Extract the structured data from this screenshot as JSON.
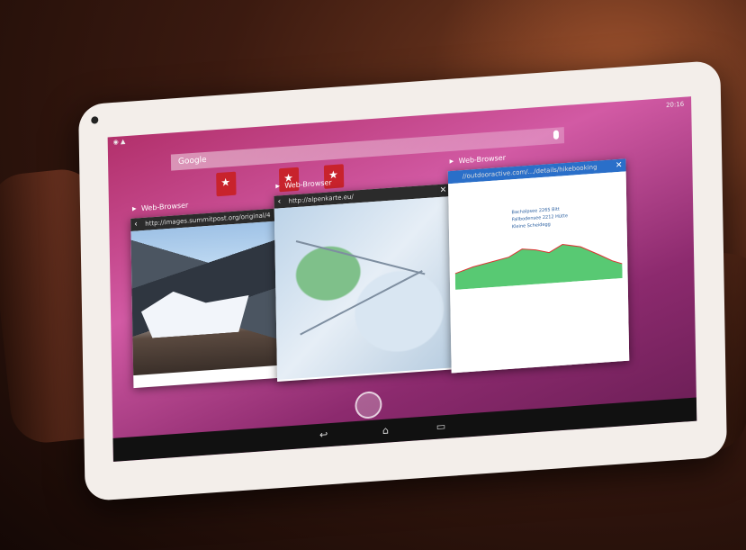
{
  "scene": "tablet held in hands showing recent apps",
  "colors": {
    "accent": "#c8232c",
    "wallpaper": "#b2306b"
  },
  "statusbar": {
    "time": "20:16",
    "icons": [
      "signal-icon",
      "wifi-icon",
      "battery-icon"
    ]
  },
  "search": {
    "label": "Google"
  },
  "cards": [
    {
      "title": "Web-Browser",
      "url": "http://images.summitpost.org/original/4"
    },
    {
      "title": "Web-Browser",
      "url": "http://alpenkarte.eu/"
    },
    {
      "title": "Web-Browser",
      "url": "//outdooractive.com/.../details/hikebooking"
    }
  ],
  "chart_labels": [
    "Bachalpsee 2265 Bitt",
    "Fallbodensee 2212 Hütte",
    "Kleine Scheidegg"
  ],
  "navbar": [
    "back-icon",
    "home-icon",
    "recents-icon"
  ]
}
